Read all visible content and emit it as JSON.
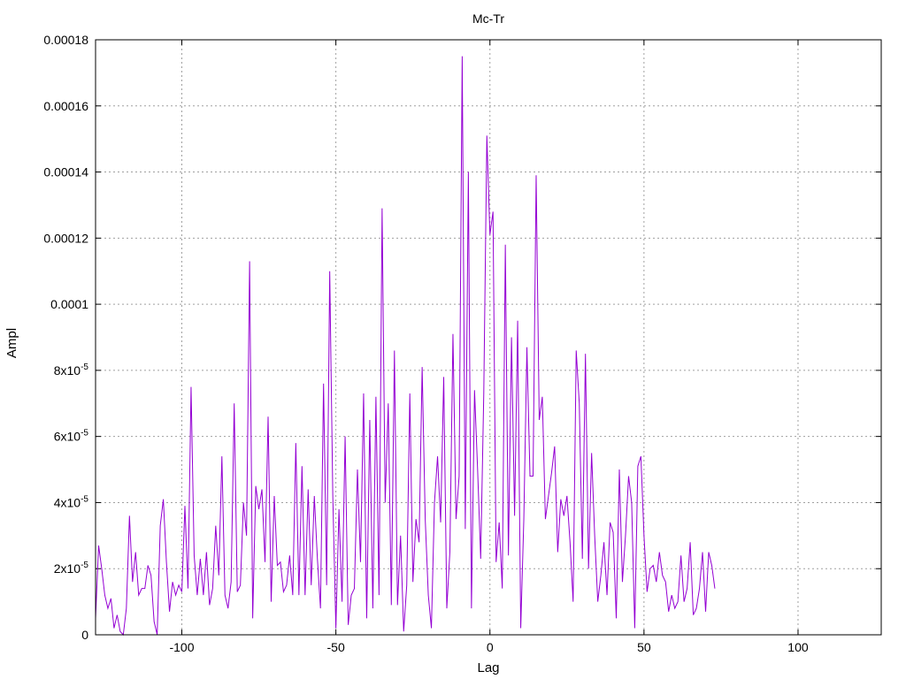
{
  "chart_data": {
    "type": "line",
    "title": "Mc-Tr",
    "xlabel": "Lag",
    "ylabel": "Ampl",
    "xlim": [
      -128,
      127
    ],
    "ylim": [
      0,
      0.00018
    ],
    "grid": true,
    "x_ticks": [
      -100,
      -50,
      0,
      50,
      100
    ],
    "x_tick_labels": [
      "-100",
      "-50",
      "0",
      "50",
      "100"
    ],
    "y_ticks": [
      0,
      2e-05,
      4e-05,
      6e-05,
      8e-05,
      0.0001,
      0.00012,
      0.00014,
      0.00016,
      0.00018
    ],
    "y_tick_labels": [
      {
        "base": "0",
        "exp": ""
      },
      {
        "base": "2x10",
        "exp": "-5"
      },
      {
        "base": "4x10",
        "exp": "-5"
      },
      {
        "base": "6x10",
        "exp": "-5"
      },
      {
        "base": "8x10",
        "exp": "-5"
      },
      {
        "base": "0.0001",
        "exp": ""
      },
      {
        "base": "0.00012",
        "exp": ""
      },
      {
        "base": "0.00014",
        "exp": ""
      },
      {
        "base": "0.00016",
        "exp": ""
      },
      {
        "base": "0.00018",
        "exp": ""
      }
    ],
    "series": [
      {
        "color": "#9400d3",
        "points": [
          [
            -128,
            5e-06
          ],
          [
            -127,
            2.7e-05
          ],
          [
            -126,
            2e-05
          ],
          [
            -125,
            1.2e-05
          ],
          [
            -124,
            8e-06
          ],
          [
            -123,
            1.1e-05
          ],
          [
            -122,
            2e-06
          ],
          [
            -121,
            6e-06
          ],
          [
            -120,
            1e-06
          ],
          [
            -119,
            0.0
          ],
          [
            -118,
            8e-06
          ],
          [
            -117,
            3.6e-05
          ],
          [
            -116,
            1.6e-05
          ],
          [
            -115,
            2.5e-05
          ],
          [
            -114,
            1.2e-05
          ],
          [
            -113,
            1.4e-05
          ],
          [
            -112,
            1.4e-05
          ],
          [
            -111,
            2.1e-05
          ],
          [
            -110,
            1.8e-05
          ],
          [
            -109,
            4e-06
          ],
          [
            -108,
            0.0
          ],
          [
            -107,
            3.3e-05
          ],
          [
            -106,
            4.1e-05
          ],
          [
            -105,
            2.2e-05
          ],
          [
            -104,
            7e-06
          ],
          [
            -103,
            1.6e-05
          ],
          [
            -102,
            1.2e-05
          ],
          [
            -101,
            1.5e-05
          ],
          [
            -100,
            1.3e-05
          ],
          [
            -99,
            3.9e-05
          ],
          [
            -98,
            1.4e-05
          ],
          [
            -97,
            7.5e-05
          ],
          [
            -96,
            2.4e-05
          ],
          [
            -95,
            1.2e-05
          ],
          [
            -94,
            2.3e-05
          ],
          [
            -93,
            1.2e-05
          ],
          [
            -92,
            2.5e-05
          ],
          [
            -91,
            9e-06
          ],
          [
            -90,
            1.4e-05
          ],
          [
            -89,
            3.3e-05
          ],
          [
            -88,
            1.8e-05
          ],
          [
            -87,
            5.4e-05
          ],
          [
            -86,
            1.2e-05
          ],
          [
            -85,
            8e-06
          ],
          [
            -84,
            1.6e-05
          ],
          [
            -83,
            7e-05
          ],
          [
            -82,
            1.3e-05
          ],
          [
            -81,
            1.5e-05
          ],
          [
            -80,
            4e-05
          ],
          [
            -79,
            3e-05
          ],
          [
            -78,
            0.000113
          ],
          [
            -77,
            5e-06
          ],
          [
            -76,
            4.5e-05
          ],
          [
            -75,
            3.8e-05
          ],
          [
            -74,
            4.4e-05
          ],
          [
            -73,
            2.2e-05
          ],
          [
            -72,
            6.6e-05
          ],
          [
            -71,
            1e-05
          ],
          [
            -70,
            4.2e-05
          ],
          [
            -69,
            2.1e-05
          ],
          [
            -68,
            2.2e-05
          ],
          [
            -67,
            1.3e-05
          ],
          [
            -66,
            1.5e-05
          ],
          [
            -65,
            2.4e-05
          ],
          [
            -64,
            1.2e-05
          ],
          [
            -63,
            5.8e-05
          ],
          [
            -62,
            1.2e-05
          ],
          [
            -61,
            5.1e-05
          ],
          [
            -60,
            1.2e-05
          ],
          [
            -59,
            4.4e-05
          ],
          [
            -58,
            1.5e-05
          ],
          [
            -57,
            4.2e-05
          ],
          [
            -56,
            2.3e-05
          ],
          [
            -55,
            8e-06
          ],
          [
            -54,
            7.6e-05
          ],
          [
            -53,
            1.5e-05
          ],
          [
            -52,
            0.00011
          ],
          [
            -51,
            4.2e-05
          ],
          [
            -50,
            2e-06
          ],
          [
            -49,
            3.8e-05
          ],
          [
            -48,
            1e-05
          ],
          [
            -47,
            6e-05
          ],
          [
            -46,
            3e-06
          ],
          [
            -45,
            1.2e-05
          ],
          [
            -44,
            1.4e-05
          ],
          [
            -43,
            5e-05
          ],
          [
            -42,
            2.2e-05
          ],
          [
            -41,
            7.3e-05
          ],
          [
            -40,
            5e-06
          ],
          [
            -39,
            6.5e-05
          ],
          [
            -38,
            8e-06
          ],
          [
            -37,
            7.2e-05
          ],
          [
            -36,
            1.2e-05
          ],
          [
            -35,
            0.000129
          ],
          [
            -34,
            4e-05
          ],
          [
            -33,
            7e-05
          ],
          [
            -32,
            9e-06
          ],
          [
            -31,
            8.6e-05
          ],
          [
            -30,
            9e-06
          ],
          [
            -29,
            3e-05
          ],
          [
            -28,
            1e-06
          ],
          [
            -27,
            1.5e-05
          ],
          [
            -26,
            7.3e-05
          ],
          [
            -25,
            1.6e-05
          ],
          [
            -24,
            3.5e-05
          ],
          [
            -23,
            2.8e-05
          ],
          [
            -22,
            8.1e-05
          ],
          [
            -21,
            3.5e-05
          ],
          [
            -20,
            1.2e-05
          ],
          [
            -19,
            2e-06
          ],
          [
            -18,
            4e-05
          ],
          [
            -17,
            5.4e-05
          ],
          [
            -16,
            3.4e-05
          ],
          [
            -15,
            7.8e-05
          ],
          [
            -14,
            8e-06
          ],
          [
            -13,
            2.5e-05
          ],
          [
            -12,
            9.1e-05
          ],
          [
            -11,
            3.5e-05
          ],
          [
            -10,
            4.8e-05
          ],
          [
            -9,
            0.000175
          ],
          [
            -8,
            3.2e-05
          ],
          [
            -7,
            0.00014
          ],
          [
            -6,
            8e-06
          ],
          [
            -5,
            7.4e-05
          ],
          [
            -4,
            5e-05
          ],
          [
            -3,
            2.3e-05
          ],
          [
            -2,
            7.3e-05
          ],
          [
            -1,
            0.000151
          ],
          [
            0,
            0.000121
          ],
          [
            1,
            0.000128
          ],
          [
            2,
            2.2e-05
          ],
          [
            3,
            3.4e-05
          ],
          [
            4,
            1.4e-05
          ],
          [
            5,
            0.000118
          ],
          [
            6,
            2.4e-05
          ],
          [
            7,
            9e-05
          ],
          [
            8,
            3.6e-05
          ],
          [
            9,
            9.5e-05
          ],
          [
            10,
            2e-06
          ],
          [
            11,
            3.5e-05
          ],
          [
            12,
            8.7e-05
          ],
          [
            13,
            4.8e-05
          ],
          [
            14,
            4.8e-05
          ],
          [
            15,
            0.000139
          ],
          [
            16,
            6.5e-05
          ],
          [
            17,
            7.2e-05
          ],
          [
            18,
            3.5e-05
          ],
          [
            19,
            4.2e-05
          ],
          [
            20,
            4.9e-05
          ],
          [
            21,
            5.7e-05
          ],
          [
            22,
            2.5e-05
          ],
          [
            23,
            4.1e-05
          ],
          [
            24,
            3.6e-05
          ],
          [
            25,
            4.2e-05
          ],
          [
            26,
            2.8e-05
          ],
          [
            27,
            1e-05
          ],
          [
            28,
            8.6e-05
          ],
          [
            29,
            7e-05
          ],
          [
            30,
            2.3e-05
          ],
          [
            31,
            8.5e-05
          ],
          [
            32,
            2e-05
          ],
          [
            33,
            5.5e-05
          ],
          [
            34,
            3e-05
          ],
          [
            35,
            1e-05
          ],
          [
            36,
            1.8e-05
          ],
          [
            37,
            2.8e-05
          ],
          [
            38,
            1.2e-05
          ],
          [
            39,
            3.4e-05
          ],
          [
            40,
            3.1e-05
          ],
          [
            41,
            5e-06
          ],
          [
            42,
            5e-05
          ],
          [
            43,
            1.6e-05
          ],
          [
            44,
            3e-05
          ],
          [
            45,
            4.8e-05
          ],
          [
            46,
            4e-05
          ],
          [
            47,
            2e-06
          ],
          [
            48,
            5.1e-05
          ],
          [
            49,
            5.4e-05
          ],
          [
            50,
            3e-05
          ],
          [
            51,
            1.3e-05
          ],
          [
            52,
            2e-05
          ],
          [
            53,
            2.1e-05
          ],
          [
            54,
            1.6e-05
          ],
          [
            55,
            2.5e-05
          ],
          [
            56,
            1.8e-05
          ],
          [
            57,
            1.6e-05
          ],
          [
            58,
            7e-06
          ],
          [
            59,
            1.2e-05
          ],
          [
            60,
            8e-06
          ],
          [
            61,
            1e-05
          ],
          [
            62,
            2.4e-05
          ],
          [
            63,
            1e-05
          ],
          [
            64,
            1.4e-05
          ],
          [
            65,
            2.8e-05
          ],
          [
            66,
            6e-06
          ],
          [
            67,
            8e-06
          ],
          [
            68,
            1.4e-05
          ],
          [
            69,
            2.5e-05
          ],
          [
            70,
            7e-06
          ],
          [
            71,
            2.5e-05
          ],
          [
            72,
            2.1e-05
          ],
          [
            73,
            1.4e-05
          ]
        ]
      }
    ]
  }
}
